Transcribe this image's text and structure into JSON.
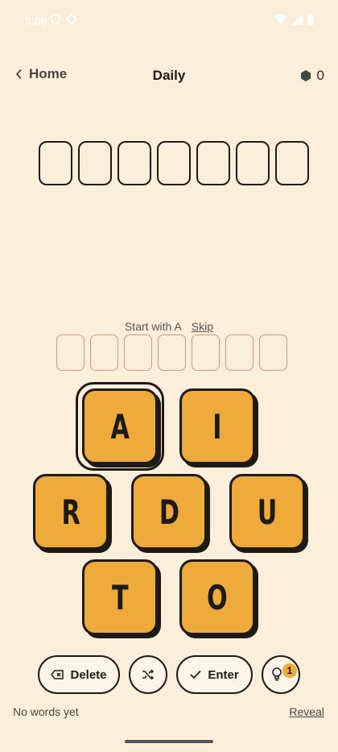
{
  "status_bar": {
    "time": "5:08"
  },
  "header": {
    "back_label": "Home",
    "title": "Daily",
    "coins": "0"
  },
  "hint": {
    "text": "Start with A",
    "skip_label": "Skip"
  },
  "answer_slot_count": 7,
  "input_slot_count": 7,
  "tiles": [
    "A",
    "I",
    "R",
    "D",
    "U",
    "T",
    "O"
  ],
  "selected_tile": "A",
  "buttons": {
    "delete_label": "Delete",
    "enter_label": "Enter",
    "hint_count": "1"
  },
  "footer": {
    "words_text": "No words yet",
    "reveal_label": "Reveal"
  },
  "colors": {
    "background": "#fbefdc",
    "tile": "#efaa3c",
    "ink": "#1e1a16",
    "slot_hint": "#d19a7a"
  }
}
